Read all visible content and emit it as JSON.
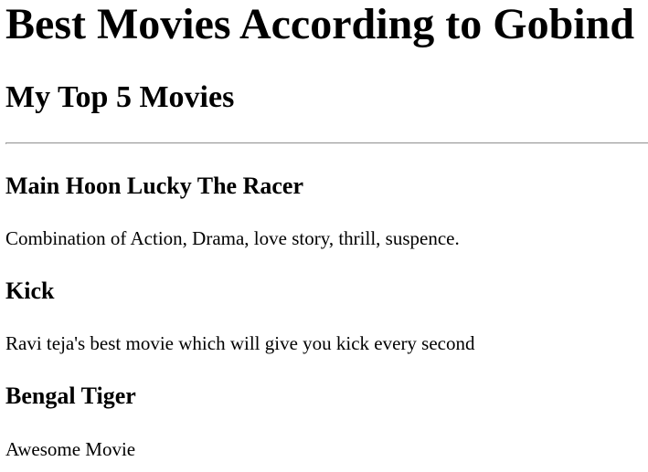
{
  "page": {
    "title": "Best Movies According to Gobind",
    "subtitle": "My Top 5 Movies"
  },
  "movies": [
    {
      "title": "Main Hoon Lucky The Racer",
      "description": "Combination of Action, Drama, love story, thrill, suspence."
    },
    {
      "title": "Kick",
      "description": "Ravi teja's best movie which will give you kick every second"
    },
    {
      "title": "Bengal Tiger",
      "description": "Awesome Movie"
    }
  ]
}
